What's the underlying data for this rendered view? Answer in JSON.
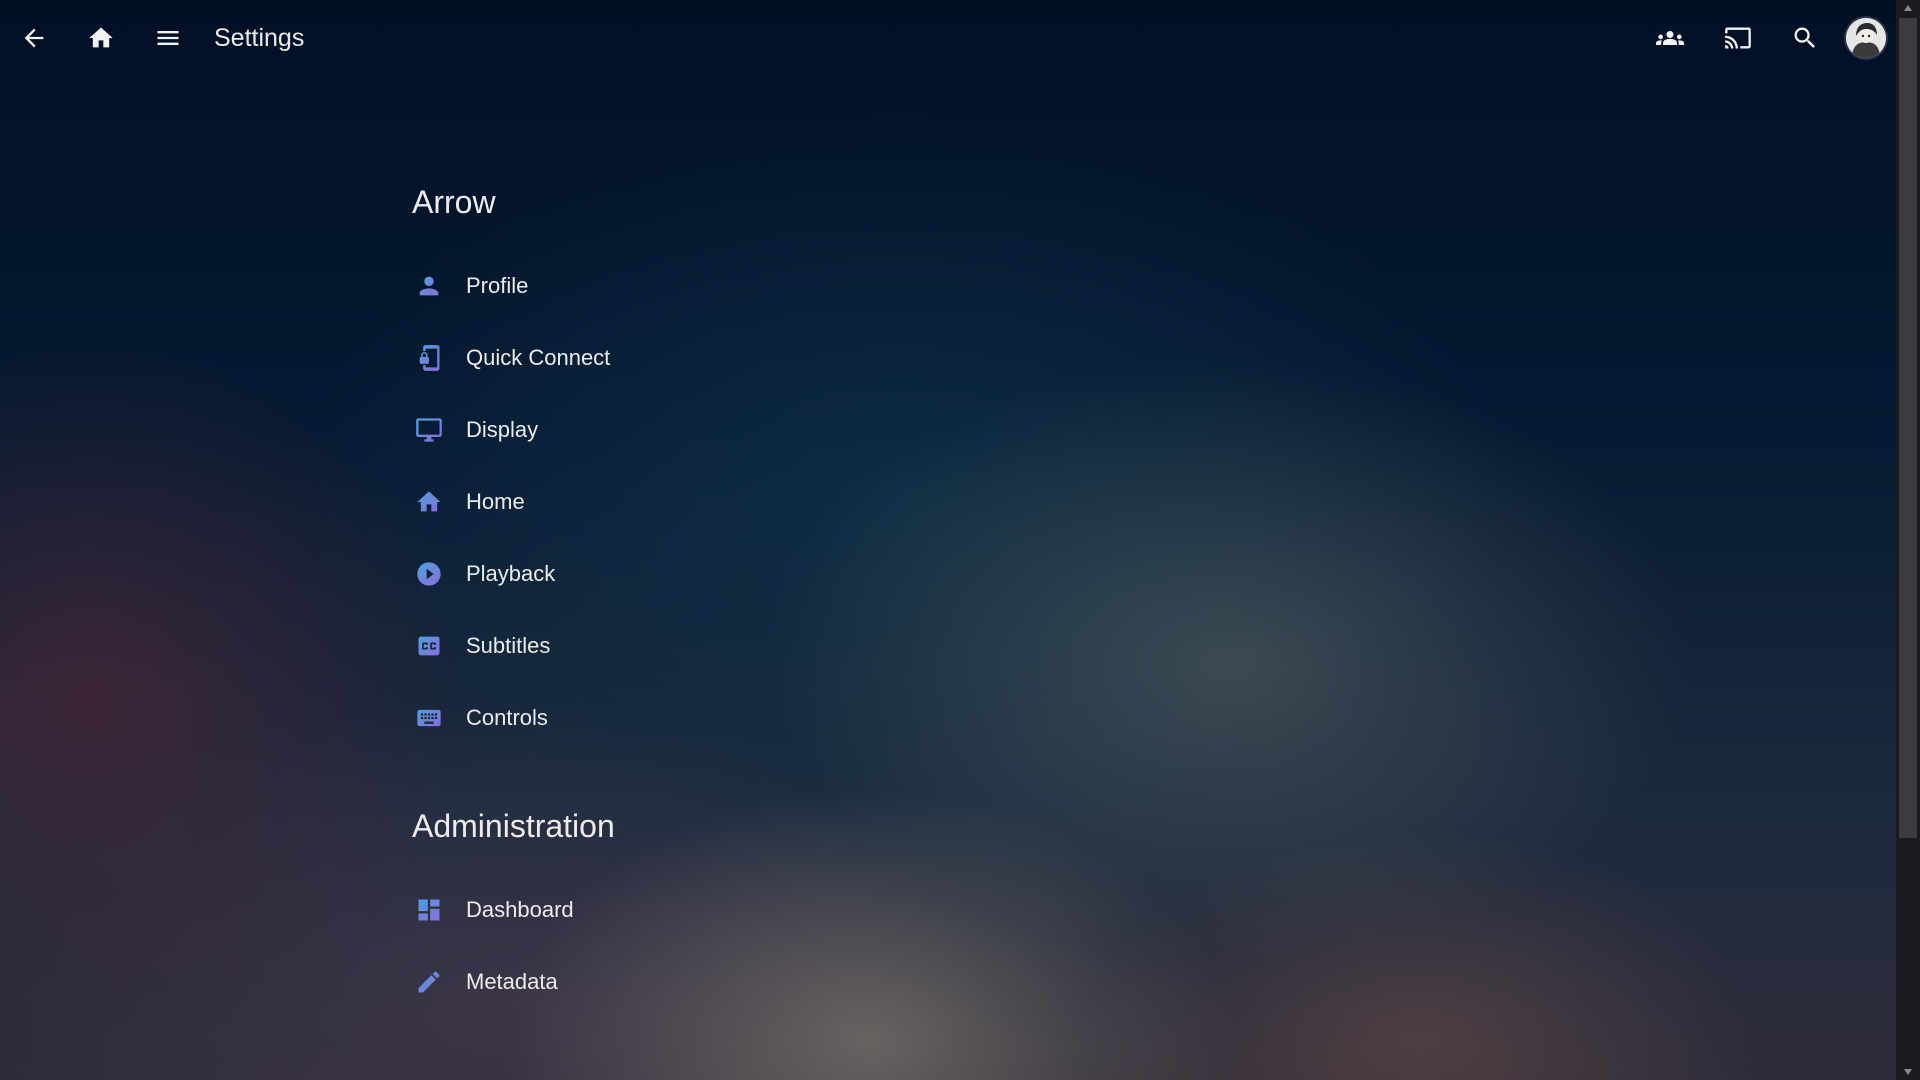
{
  "header": {
    "title": "Settings",
    "icons": {
      "back": "arrow-back-icon",
      "home": "home-icon",
      "menu": "hamburger-menu-icon",
      "syncplay": "group-icon",
      "cast": "cast-icon",
      "search": "search-icon",
      "avatar": "user-avatar"
    }
  },
  "sections": [
    {
      "title": "Arrow",
      "items": [
        {
          "label": "Profile",
          "icon": "person-icon"
        },
        {
          "label": "Quick Connect",
          "icon": "phonelink-lock-icon"
        },
        {
          "label": "Display",
          "icon": "monitor-icon"
        },
        {
          "label": "Home",
          "icon": "home-icon"
        },
        {
          "label": "Playback",
          "icon": "play-circle-icon"
        },
        {
          "label": "Subtitles",
          "icon": "closed-caption-icon"
        },
        {
          "label": "Controls",
          "icon": "keyboard-icon"
        }
      ]
    },
    {
      "title": "Administration",
      "items": [
        {
          "label": "Dashboard",
          "icon": "dashboard-icon"
        },
        {
          "label": "Metadata",
          "icon": "edit-pencil-icon"
        }
      ]
    }
  ],
  "colors": {
    "icon_gradient_start": "#4aa3df",
    "icon_gradient_end": "#8e6bd8",
    "text": "#ececec",
    "background_top": "#021026"
  }
}
